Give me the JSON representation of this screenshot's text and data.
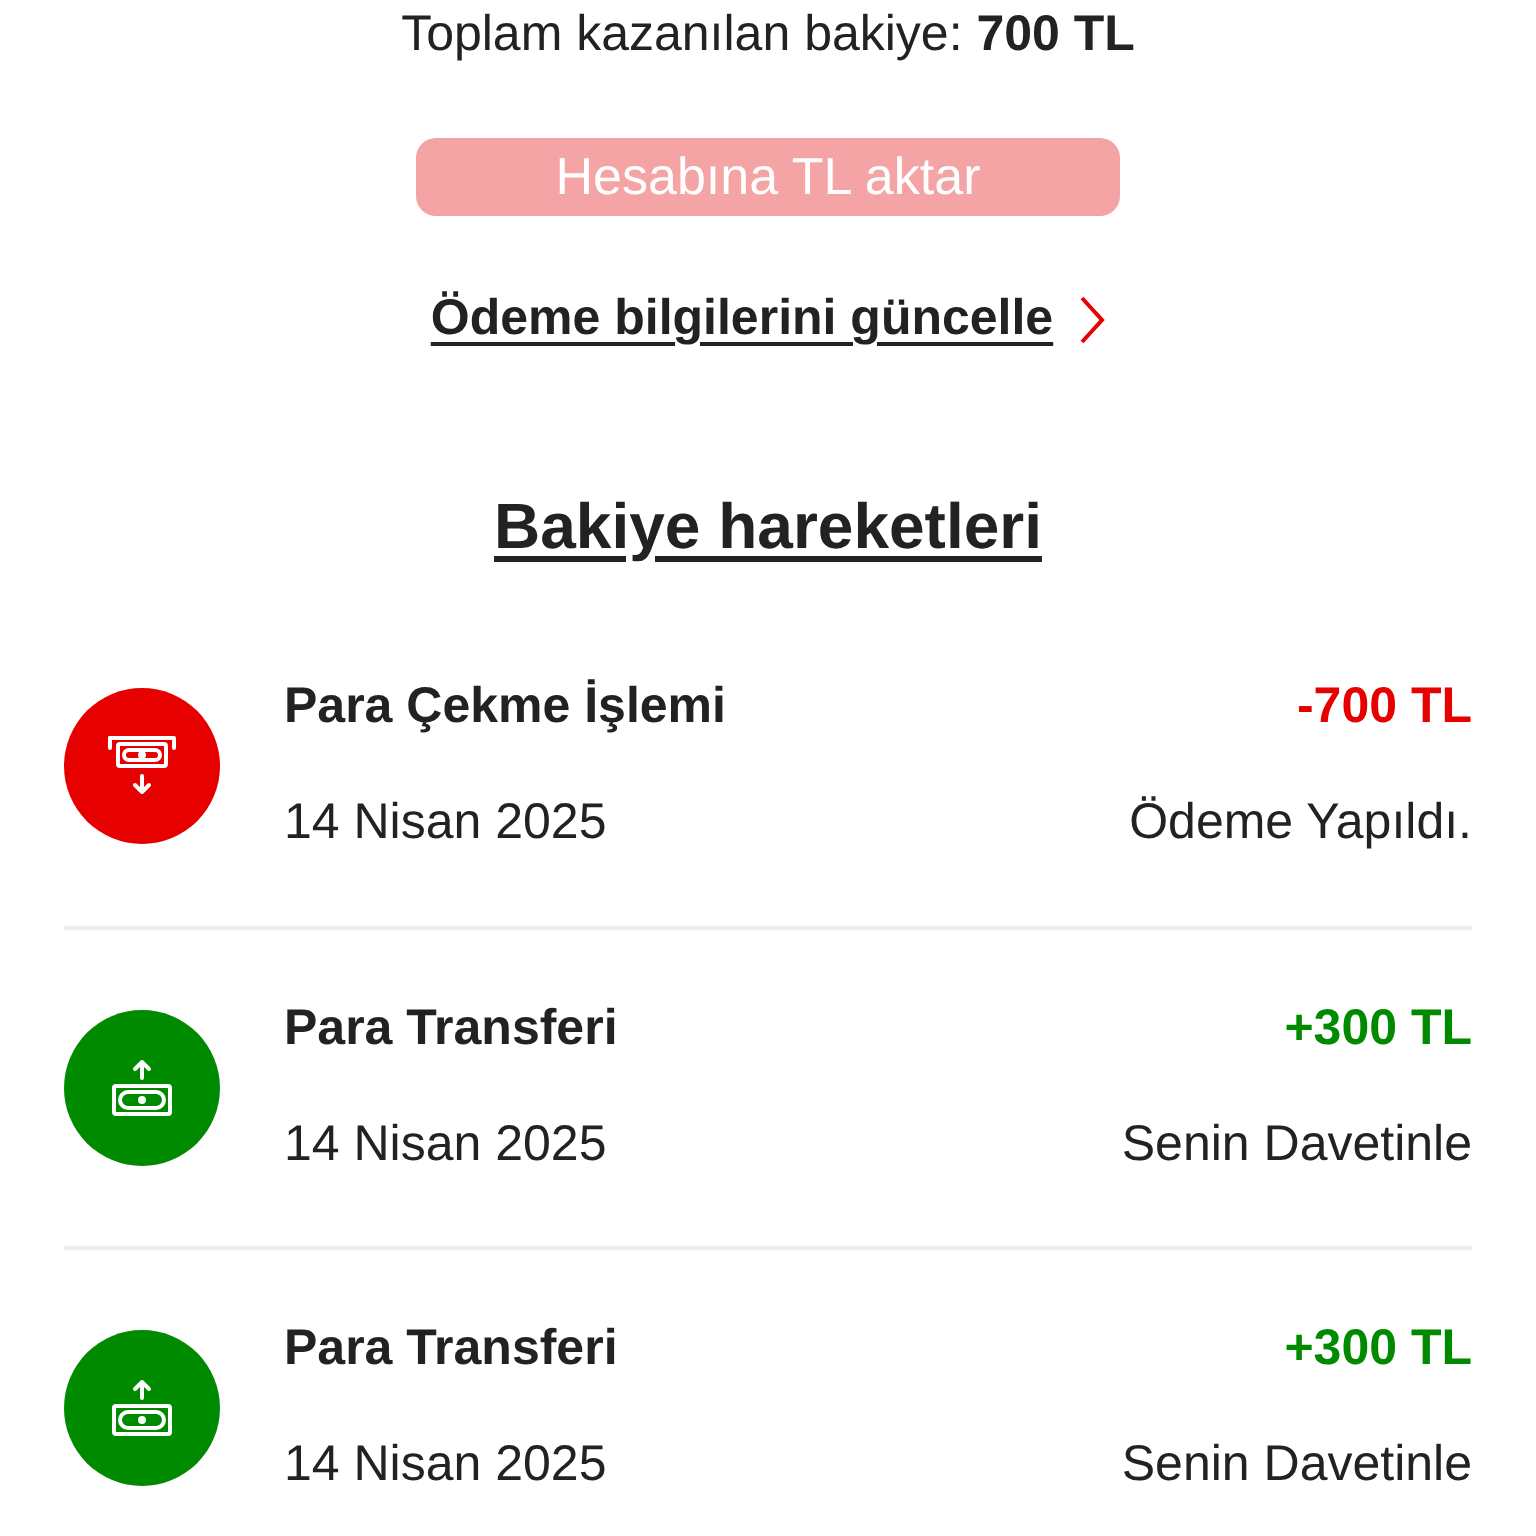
{
  "balance": {
    "label": "Toplam kazanılan bakiye:",
    "amount": "700 TL"
  },
  "transfer_button": {
    "label": "Hesabına TL aktar",
    "disabled": true
  },
  "payment_link": {
    "label": "Ödeme bilgilerini güncelle"
  },
  "history": {
    "title": "Bakiye hareketleri",
    "items": [
      {
        "kind": "withdrawal",
        "title": "Para Çekme İşlemi",
        "date": "14 Nisan 2025",
        "amount": "-700 TL",
        "status": "Ödeme Yapıldı."
      },
      {
        "kind": "deposit",
        "title": "Para Transferi",
        "date": "14 Nisan 2025",
        "amount": "+300 TL",
        "status": "Senin Davetinle"
      },
      {
        "kind": "deposit",
        "title": "Para Transferi",
        "date": "14 Nisan 2025",
        "amount": "+300 TL",
        "status": "Senin Davetinle"
      }
    ]
  }
}
